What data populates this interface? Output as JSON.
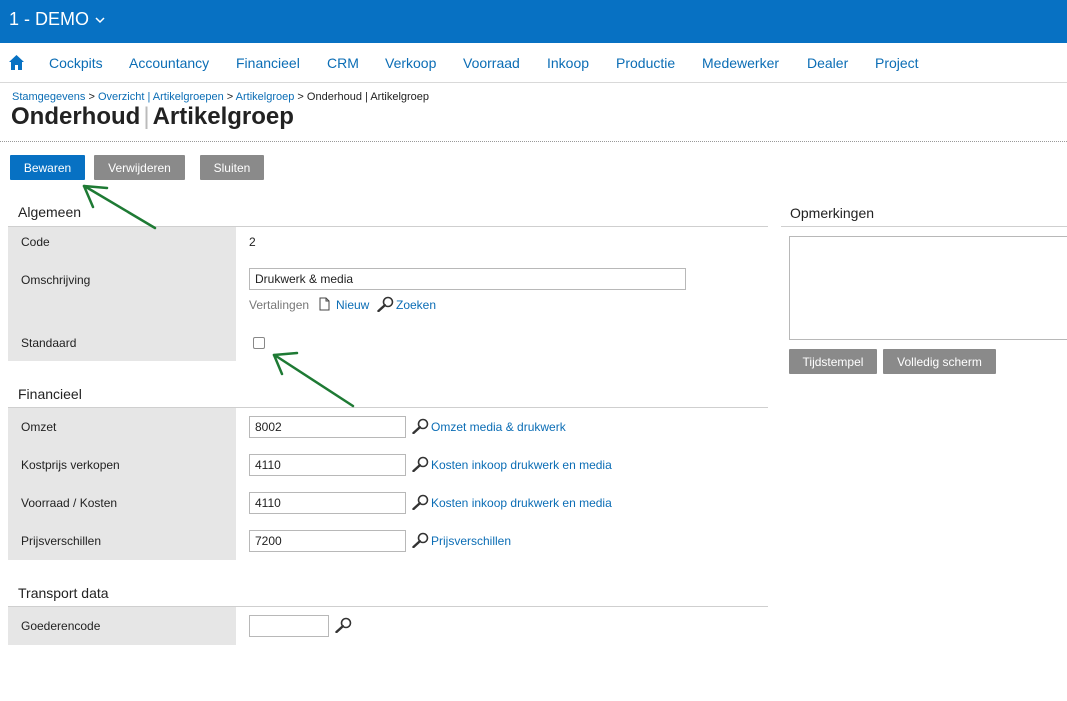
{
  "header": {
    "company": "1 - DEMO"
  },
  "nav": {
    "items": [
      {
        "label": "Cockpits"
      },
      {
        "label": "Accountancy"
      },
      {
        "label": "Financieel"
      },
      {
        "label": "CRM"
      },
      {
        "label": "Verkoop"
      },
      {
        "label": "Voorraad"
      },
      {
        "label": "Inkoop"
      },
      {
        "label": "Productie"
      },
      {
        "label": "Medewerker"
      },
      {
        "label": "Dealer"
      },
      {
        "label": "Project"
      }
    ]
  },
  "breadcrumb": {
    "items": [
      "Stamgegevens",
      "Overzicht | Artikelgroepen",
      "Artikelgroep"
    ],
    "current": "Onderhoud | Artikelgroep",
    "separator": ">"
  },
  "page": {
    "title_main": "Onderhoud",
    "title_sub": "Artikelgroep",
    "title_sep": "|"
  },
  "toolbar": {
    "save": "Bewaren",
    "delete": "Verwijderen",
    "close": "Sluiten"
  },
  "algemeen": {
    "title": "Algemeen",
    "code_label": "Code",
    "code_value": "2",
    "desc_label": "Omschrijving",
    "desc_value": "Drukwerk & media",
    "translations_label": "Vertalingen",
    "new_label": "Nieuw",
    "search_label": "Zoeken",
    "default_label": "Standaard",
    "default_checked": false
  },
  "financieel": {
    "title": "Financieel",
    "rows": [
      {
        "label": "Omzet",
        "value": "8002",
        "link": "Omzet media & drukwerk"
      },
      {
        "label": "Kostprijs verkopen",
        "value": "4110",
        "link": "Kosten inkoop drukwerk en media"
      },
      {
        "label": "Voorraad / Kosten",
        "value": "4110",
        "link": "Kosten inkoop drukwerk en media"
      },
      {
        "label": "Prijsverschillen",
        "value": "7200",
        "link": "Prijsverschillen"
      }
    ]
  },
  "transport": {
    "title": "Transport data",
    "code_label": "Goederencode",
    "code_value": ""
  },
  "remarks": {
    "title": "Opmerkingen",
    "timestamp_button": "Tijdstempel",
    "fullscreen_button": "Volledig scherm",
    "value": ""
  },
  "colors": {
    "primary": "#0771c3",
    "link": "#0b6db5",
    "button_grey": "#8a8a8a",
    "label_bg": "#e6e6e6",
    "arrow": "#1e7a34"
  }
}
